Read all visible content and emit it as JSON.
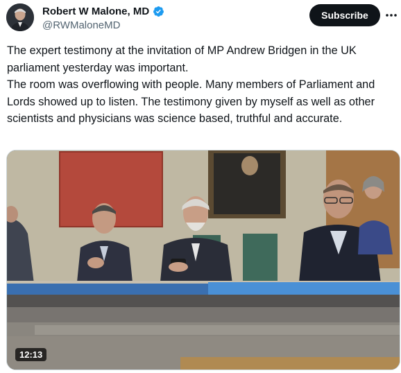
{
  "author": {
    "display_name": "Robert W Malone, MD",
    "handle": "@RWMaloneMD",
    "verified_icon": "verified-badge-icon"
  },
  "actions": {
    "subscribe_label": "Subscribe",
    "more_icon": "more-options-icon"
  },
  "tweet": {
    "paragraphs": [
      "The expert testimony at the invitation of MP Andrew Bridgen in the UK parliament yesterday was important.",
      "The room was overflowing with people.  Many members of Parliament and Lords showed up to listen.  The testimony given by myself as well as other scientists and physicians was science based, truthful and accurate."
    ]
  },
  "media": {
    "type": "video",
    "duration": "12:13"
  },
  "colors": {
    "text": "#0f1419",
    "secondary": "#536471",
    "verified": "#1d9bf0",
    "button_bg": "#0f1419"
  }
}
